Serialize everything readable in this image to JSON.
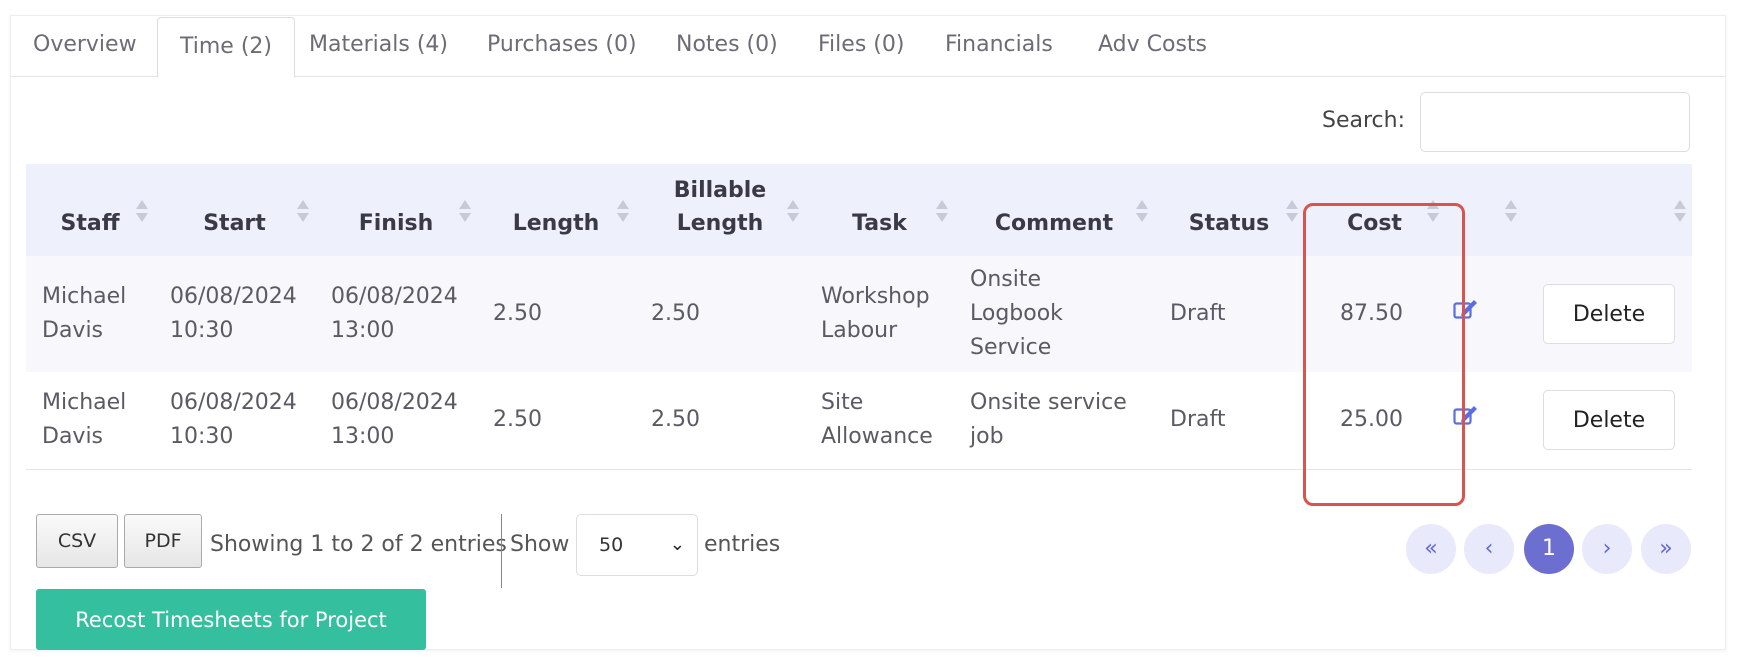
{
  "tabs": [
    {
      "label": "Overview"
    },
    {
      "label": "Time (2)"
    },
    {
      "label": "Materials (4)"
    },
    {
      "label": "Purchases (0)"
    },
    {
      "label": "Notes (0)"
    },
    {
      "label": "Files (0)"
    },
    {
      "label": "Financials"
    },
    {
      "label": "Adv Costs"
    }
  ],
  "active_tab": "Time (2)",
  "search": {
    "label": "Search:",
    "value": ""
  },
  "table": {
    "headers": [
      "Staff",
      "Start",
      "Finish",
      "Length",
      "Billable Length",
      "Task",
      "Comment",
      "Status",
      "Cost",
      "",
      ""
    ],
    "rows": [
      {
        "staff": "Michael Davis",
        "start": "06/08/2024 10:30",
        "finish": "06/08/2024 13:00",
        "length": "2.50",
        "billable": "2.50",
        "task": "Workshop Labour",
        "comment": "Onsite Logbook Service",
        "status": "Draft",
        "cost": "87.50",
        "delete": "Delete"
      },
      {
        "staff": "Michael Davis",
        "start": "06/08/2024 10:30",
        "finish": "06/08/2024 13:00",
        "length": "2.50",
        "billable": "2.50",
        "task": "Site Allowance",
        "comment": "Onsite service job",
        "status": "Draft",
        "cost": "25.00",
        "delete": "Delete"
      }
    ]
  },
  "footer": {
    "csv": "CSV",
    "pdf": "PDF",
    "info": "Showing 1 to 2 of 2 entries",
    "show": "Show",
    "page_size": "50",
    "entries": "entries",
    "pagination": {
      "first": "«",
      "prev": "‹",
      "current": "1",
      "next": "›",
      "last": "»"
    }
  },
  "recost_button": "Recost Timesheets for Project",
  "colors": {
    "accent": "#6c6fcf",
    "success": "#34bf9e",
    "highlight": "#d9534f"
  }
}
